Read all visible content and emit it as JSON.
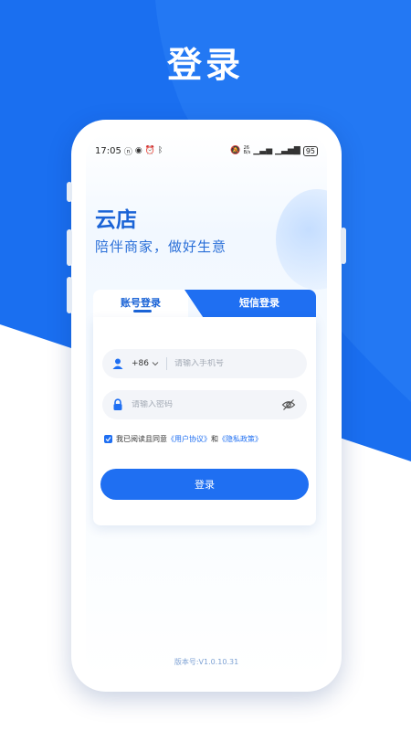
{
  "page": {
    "heading": "登录",
    "colors": {
      "brand_blue": "#1f6ff2",
      "bg_blue": "#1a6ff0",
      "title_blue": "#1a63d6"
    }
  },
  "status_bar": {
    "time": "17:05",
    "left_icons": [
      "nfc-icon",
      "eye-icon",
      "alarm-icon",
      "bluetooth-icon"
    ],
    "right_icons": [
      "mute-icon",
      "network-speed-icon",
      "signal-icon",
      "signal-icon"
    ],
    "speed": "26",
    "speed_unit": "B/s",
    "battery": "95"
  },
  "brand": {
    "title": "云店",
    "slogan": "陪伴商家，做好生意"
  },
  "tabs": {
    "account": "账号登录",
    "sms": "短信登录",
    "active": "account"
  },
  "form": {
    "country_code": "+86",
    "phone_placeholder": "请输入手机号",
    "password_placeholder": "请输入密码",
    "agree_prefix": "我已阅读且同意",
    "user_agreement": "《用户协议》",
    "and": "和",
    "privacy_policy": "《隐私政策》",
    "login_label": "登录"
  },
  "footer": {
    "version": "版本号:V1.0.10.31"
  }
}
